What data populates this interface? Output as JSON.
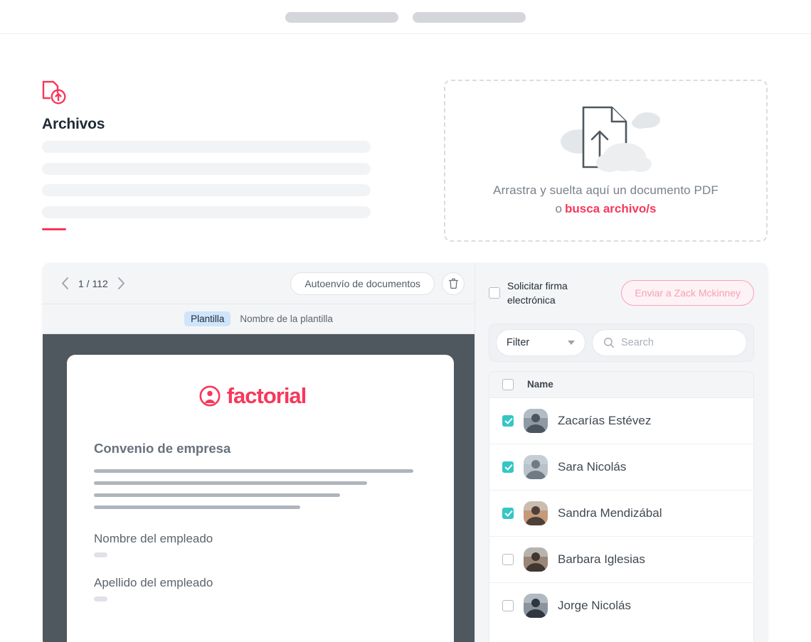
{
  "browser": {
    "tab_placeholder_1": "",
    "tab_placeholder_2": ""
  },
  "files_section": {
    "title": "Archivos",
    "accent_color": "#f7385b"
  },
  "dropzone": {
    "line1": "Arrastra y suelta aquí un documento PDF",
    "prefix": "o",
    "link": "busca archivo/s"
  },
  "doc_toolbar": {
    "page_label": "1 / 112",
    "autosend_label": "Autoenvío de documentos",
    "delete_tooltip": "Eliminar"
  },
  "doc_tabs": {
    "active": "Plantilla",
    "secondary": "Nombre de la plantilla"
  },
  "document": {
    "brand": "factorial",
    "heading": "Convenio de empresa",
    "body_lines": [
      96,
      82,
      74,
      62
    ],
    "fields": [
      {
        "label": "Nombre del empleado"
      },
      {
        "label": "Apellido del empleado"
      }
    ]
  },
  "people_panel": {
    "signature_label": "Solicitar firma electrónica",
    "signature_checked": false,
    "send_button": "Enviar a Zack Mckinney",
    "filter_label": "Filter",
    "search_placeholder": "Search",
    "column_header": "Name",
    "select_all_checked": false,
    "checkbox_color": "#35c6c6",
    "rows": [
      {
        "name": "Zacarías Estévez",
        "checked": true,
        "avatar_a": "#8d9aa6",
        "avatar_b": "#4a5560"
      },
      {
        "name": "Sara Nicolás",
        "checked": true,
        "avatar_a": "#b9c2c9",
        "avatar_b": "#6f7a84"
      },
      {
        "name": "Sandra Mendizábal",
        "checked": true,
        "avatar_a": "#c59a7a",
        "avatar_b": "#4e4038"
      },
      {
        "name": "Barbara Iglesias",
        "checked": false,
        "avatar_a": "#9a8576",
        "avatar_b": "#3f3730"
      },
      {
        "name": "Jorge Nicolás",
        "checked": false,
        "avatar_a": "#8b949c",
        "avatar_b": "#2f3640"
      }
    ]
  }
}
